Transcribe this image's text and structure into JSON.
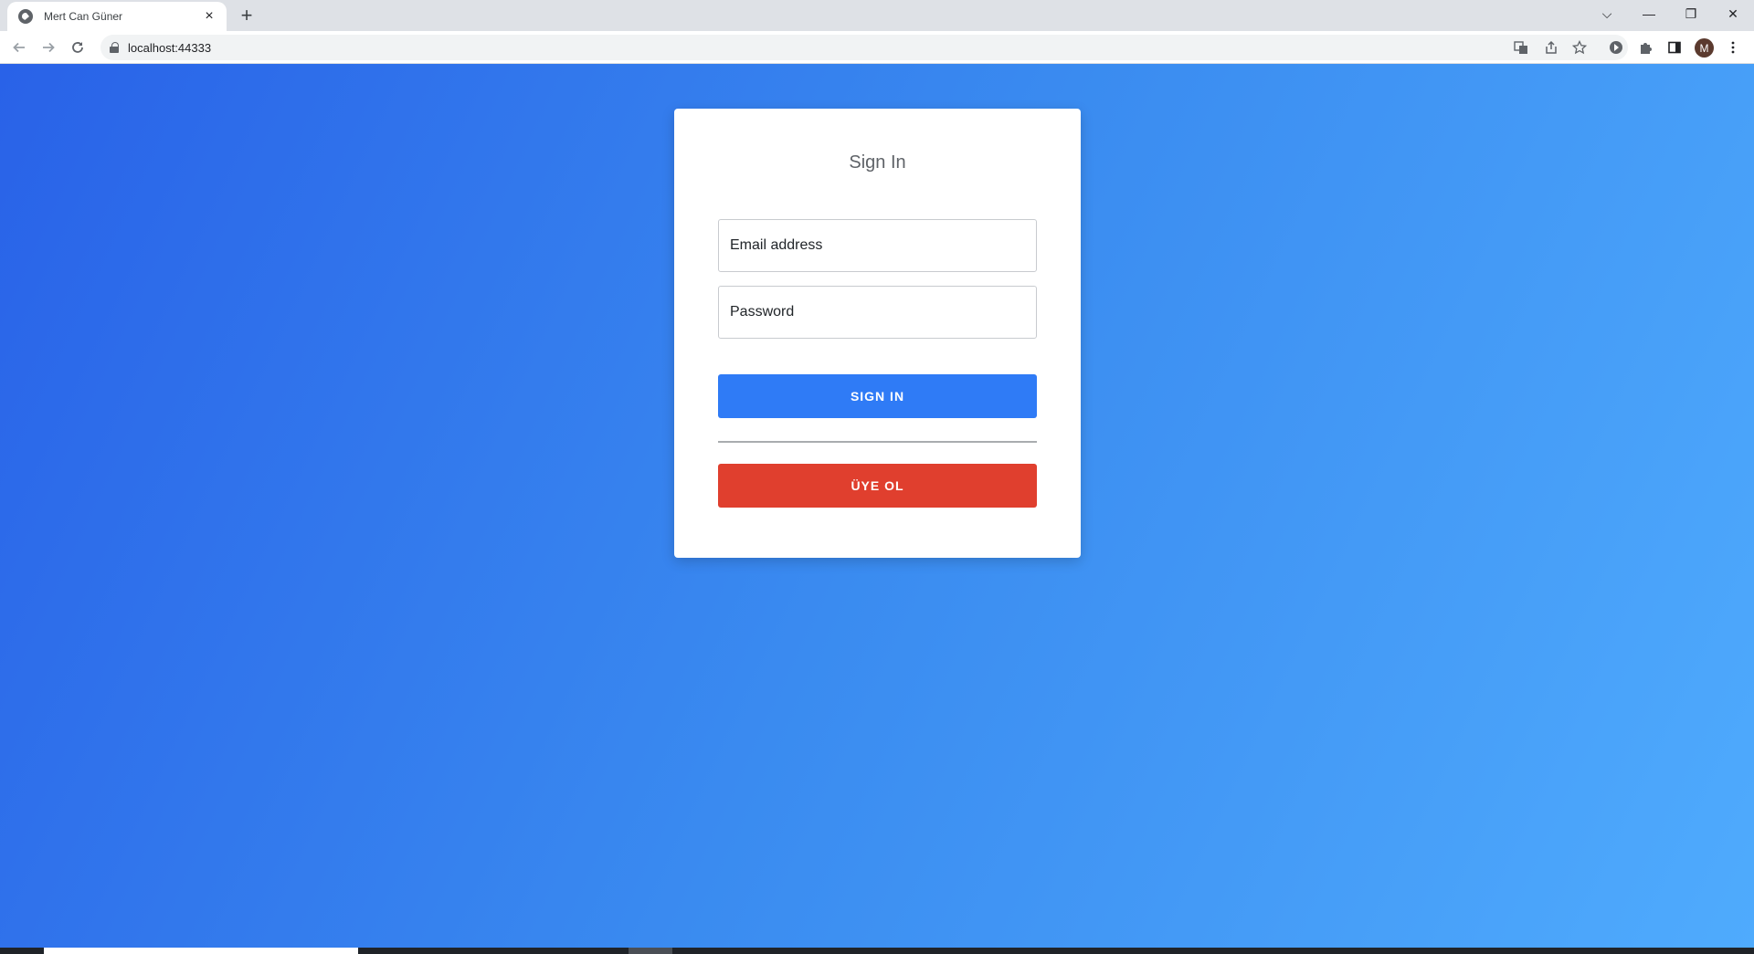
{
  "browser": {
    "tab_title": "Mert Can Güner",
    "tab_close": "×",
    "new_tab": "+",
    "url": "localhost:44333",
    "profile_initial": "M",
    "window_controls": {
      "dropdown": "⌵",
      "minimize": "—",
      "restore": "❐",
      "close": "✕"
    }
  },
  "signin_card": {
    "title": "Sign In",
    "email_placeholder": "Email address",
    "password_placeholder": "Password",
    "signin_label": "SIGN IN",
    "register_label": "ÜYE OL"
  },
  "colors": {
    "gradient_start": "#2962e8",
    "gradient_end": "#4fabfd",
    "signin_button": "#2f7bf6",
    "register_button": "#e03f2e"
  },
  "icons": {
    "favicon": "globe-icon",
    "back": "arrow-left-icon",
    "forward": "arrow-right-icon",
    "reload": "reload-icon",
    "lock": "lock-icon",
    "translate": "translate-icon",
    "share": "share-icon",
    "bookmark": "star-icon",
    "extension_a": "extension-icon",
    "extensions": "puzzle-icon",
    "side_panel": "side-panel-icon",
    "menu": "more-vert-icon"
  }
}
